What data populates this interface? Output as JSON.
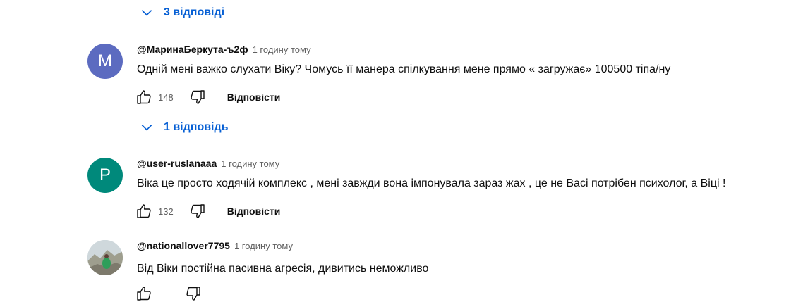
{
  "replies_toggle_1": {
    "label": "3 відповіді"
  },
  "replies_toggle_2": {
    "label": "1 відповідь"
  },
  "comments": [
    {
      "author": "@МаринаБеркута-ъ2ф",
      "time": "1 годину тому",
      "text": "Одній мені важко слухати Віку? Чомусь її манера спілкування мене прямо « загружає» 100500 тіпа/ну",
      "likes": "148",
      "reply_label": "Відповісти",
      "avatar_letter": "M",
      "avatar_color": "#5c6bc0"
    },
    {
      "author": "@user-ruslanaaa",
      "time": "1 годину тому",
      "text": "Віка це просто ходячій комплекс , мені завжди вона імпонувала зараз жах , це не Васі потрібен психолог, а Віці !",
      "likes": "132",
      "reply_label": "Відповісти",
      "avatar_letter": "P",
      "avatar_color": "#00897b"
    },
    {
      "author": "@nationallover7795",
      "time": "1 годину тому",
      "text": "Від Віки постійна пасивна агресія, дивитись неможливо",
      "avatar_type": "photo"
    }
  ],
  "colors": {
    "link_blue": "#065fd4",
    "secondary_text": "#606060"
  }
}
